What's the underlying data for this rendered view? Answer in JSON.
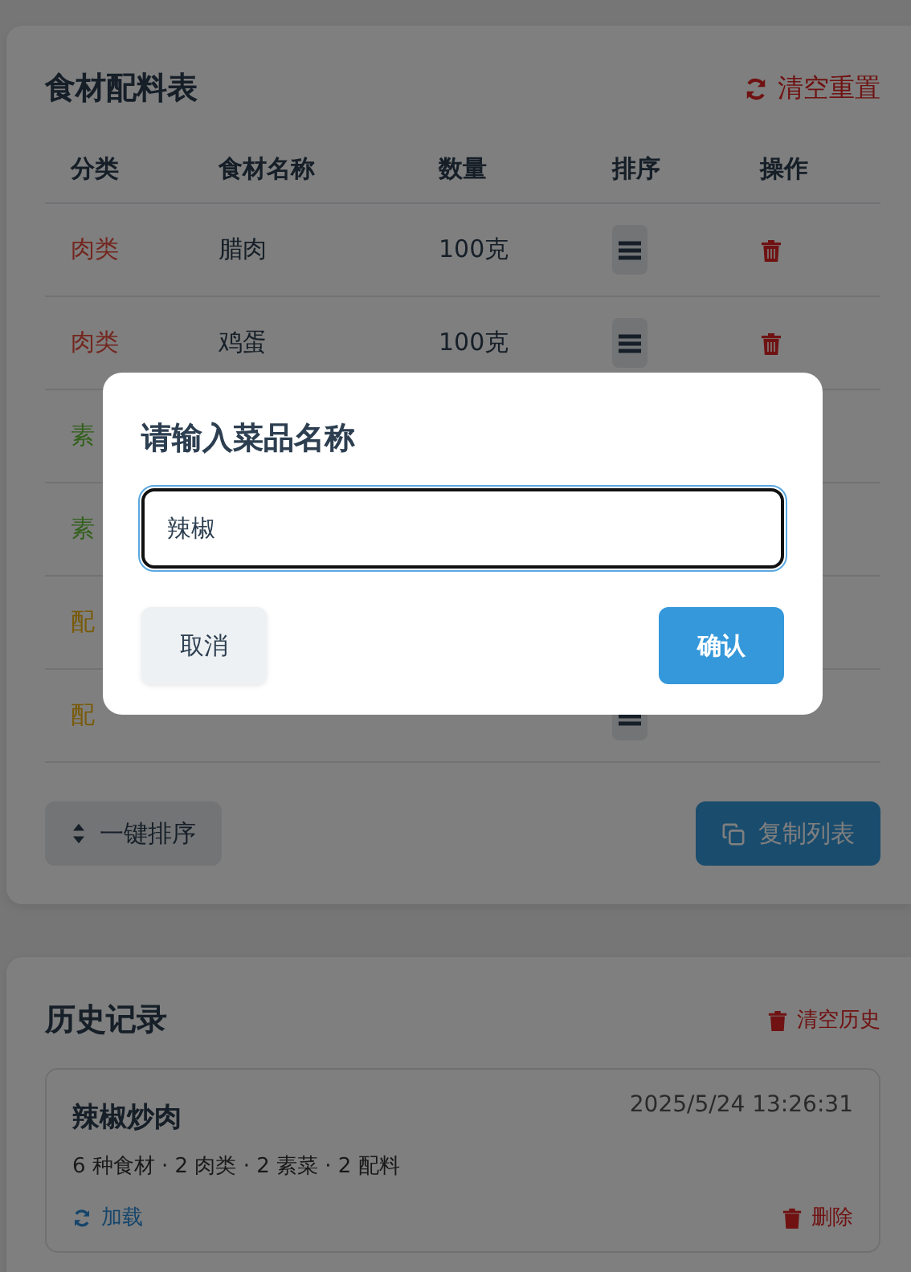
{
  "ingredients": {
    "title": "食材配料表",
    "reset_button": "清空重置",
    "columns": [
      "分类",
      "食材名称",
      "数量",
      "排序",
      "操作"
    ],
    "rows": [
      {
        "category": "肉类",
        "kind": "meat",
        "name": "腊肉",
        "quantity": "100克",
        "handle": true,
        "delete": true
      },
      {
        "category": "肉类",
        "kind": "meat",
        "name": "鸡蛋",
        "quantity": "100克",
        "handle": true,
        "delete": true
      },
      {
        "category": "素",
        "kind": "vegetable"
      },
      {
        "category": "素",
        "kind": "vegetable"
      },
      {
        "category": "配",
        "kind": "seasoning"
      },
      {
        "category": "配",
        "kind": "seasoning",
        "handle": true
      }
    ],
    "sort_button": "一键排序",
    "copy_button": "复制列表"
  },
  "dialog": {
    "title": "请输入菜品名称",
    "value": "辣椒",
    "cancel_button": "取消",
    "confirm_button": "确认"
  },
  "history": {
    "title": "历史记录",
    "clear_button": "清空历史",
    "entries": [
      {
        "name": "辣椒炒肉",
        "time": "2025/5/24 13:26:31",
        "summary": "6 种食材 · 2 肉类 · 2 素菜 · 2 配料",
        "load_button": "加载",
        "delete_button": "删除"
      }
    ]
  }
}
